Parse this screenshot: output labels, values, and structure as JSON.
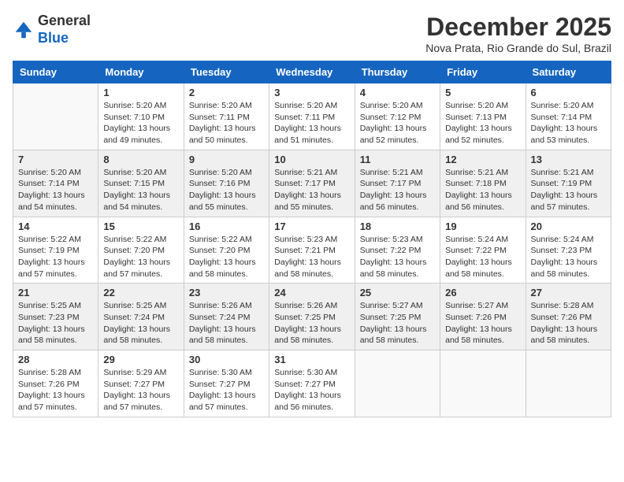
{
  "logo": {
    "general": "General",
    "blue": "Blue"
  },
  "title": "December 2025",
  "subtitle": "Nova Prata, Rio Grande do Sul, Brazil",
  "weekdays": [
    "Sunday",
    "Monday",
    "Tuesday",
    "Wednesday",
    "Thursday",
    "Friday",
    "Saturday"
  ],
  "weeks": [
    [
      {
        "day": "",
        "info": ""
      },
      {
        "day": "1",
        "info": "Sunrise: 5:20 AM\nSunset: 7:10 PM\nDaylight: 13 hours\nand 49 minutes."
      },
      {
        "day": "2",
        "info": "Sunrise: 5:20 AM\nSunset: 7:11 PM\nDaylight: 13 hours\nand 50 minutes."
      },
      {
        "day": "3",
        "info": "Sunrise: 5:20 AM\nSunset: 7:11 PM\nDaylight: 13 hours\nand 51 minutes."
      },
      {
        "day": "4",
        "info": "Sunrise: 5:20 AM\nSunset: 7:12 PM\nDaylight: 13 hours\nand 52 minutes."
      },
      {
        "day": "5",
        "info": "Sunrise: 5:20 AM\nSunset: 7:13 PM\nDaylight: 13 hours\nand 52 minutes."
      },
      {
        "day": "6",
        "info": "Sunrise: 5:20 AM\nSunset: 7:14 PM\nDaylight: 13 hours\nand 53 minutes."
      }
    ],
    [
      {
        "day": "7",
        "info": "Sunrise: 5:20 AM\nSunset: 7:14 PM\nDaylight: 13 hours\nand 54 minutes."
      },
      {
        "day": "8",
        "info": "Sunrise: 5:20 AM\nSunset: 7:15 PM\nDaylight: 13 hours\nand 54 minutes."
      },
      {
        "day": "9",
        "info": "Sunrise: 5:20 AM\nSunset: 7:16 PM\nDaylight: 13 hours\nand 55 minutes."
      },
      {
        "day": "10",
        "info": "Sunrise: 5:21 AM\nSunset: 7:17 PM\nDaylight: 13 hours\nand 55 minutes."
      },
      {
        "day": "11",
        "info": "Sunrise: 5:21 AM\nSunset: 7:17 PM\nDaylight: 13 hours\nand 56 minutes."
      },
      {
        "day": "12",
        "info": "Sunrise: 5:21 AM\nSunset: 7:18 PM\nDaylight: 13 hours\nand 56 minutes."
      },
      {
        "day": "13",
        "info": "Sunrise: 5:21 AM\nSunset: 7:19 PM\nDaylight: 13 hours\nand 57 minutes."
      }
    ],
    [
      {
        "day": "14",
        "info": "Sunrise: 5:22 AM\nSunset: 7:19 PM\nDaylight: 13 hours\nand 57 minutes."
      },
      {
        "day": "15",
        "info": "Sunrise: 5:22 AM\nSunset: 7:20 PM\nDaylight: 13 hours\nand 57 minutes."
      },
      {
        "day": "16",
        "info": "Sunrise: 5:22 AM\nSunset: 7:20 PM\nDaylight: 13 hours\nand 58 minutes."
      },
      {
        "day": "17",
        "info": "Sunrise: 5:23 AM\nSunset: 7:21 PM\nDaylight: 13 hours\nand 58 minutes."
      },
      {
        "day": "18",
        "info": "Sunrise: 5:23 AM\nSunset: 7:22 PM\nDaylight: 13 hours\nand 58 minutes."
      },
      {
        "day": "19",
        "info": "Sunrise: 5:24 AM\nSunset: 7:22 PM\nDaylight: 13 hours\nand 58 minutes."
      },
      {
        "day": "20",
        "info": "Sunrise: 5:24 AM\nSunset: 7:23 PM\nDaylight: 13 hours\nand 58 minutes."
      }
    ],
    [
      {
        "day": "21",
        "info": "Sunrise: 5:25 AM\nSunset: 7:23 PM\nDaylight: 13 hours\nand 58 minutes."
      },
      {
        "day": "22",
        "info": "Sunrise: 5:25 AM\nSunset: 7:24 PM\nDaylight: 13 hours\nand 58 minutes."
      },
      {
        "day": "23",
        "info": "Sunrise: 5:26 AM\nSunset: 7:24 PM\nDaylight: 13 hours\nand 58 minutes."
      },
      {
        "day": "24",
        "info": "Sunrise: 5:26 AM\nSunset: 7:25 PM\nDaylight: 13 hours\nand 58 minutes."
      },
      {
        "day": "25",
        "info": "Sunrise: 5:27 AM\nSunset: 7:25 PM\nDaylight: 13 hours\nand 58 minutes."
      },
      {
        "day": "26",
        "info": "Sunrise: 5:27 AM\nSunset: 7:26 PM\nDaylight: 13 hours\nand 58 minutes."
      },
      {
        "day": "27",
        "info": "Sunrise: 5:28 AM\nSunset: 7:26 PM\nDaylight: 13 hours\nand 58 minutes."
      }
    ],
    [
      {
        "day": "28",
        "info": "Sunrise: 5:28 AM\nSunset: 7:26 PM\nDaylight: 13 hours\nand 57 minutes."
      },
      {
        "day": "29",
        "info": "Sunrise: 5:29 AM\nSunset: 7:27 PM\nDaylight: 13 hours\nand 57 minutes."
      },
      {
        "day": "30",
        "info": "Sunrise: 5:30 AM\nSunset: 7:27 PM\nDaylight: 13 hours\nand 57 minutes."
      },
      {
        "day": "31",
        "info": "Sunrise: 5:30 AM\nSunset: 7:27 PM\nDaylight: 13 hours\nand 56 minutes."
      },
      {
        "day": "",
        "info": ""
      },
      {
        "day": "",
        "info": ""
      },
      {
        "day": "",
        "info": ""
      }
    ]
  ]
}
